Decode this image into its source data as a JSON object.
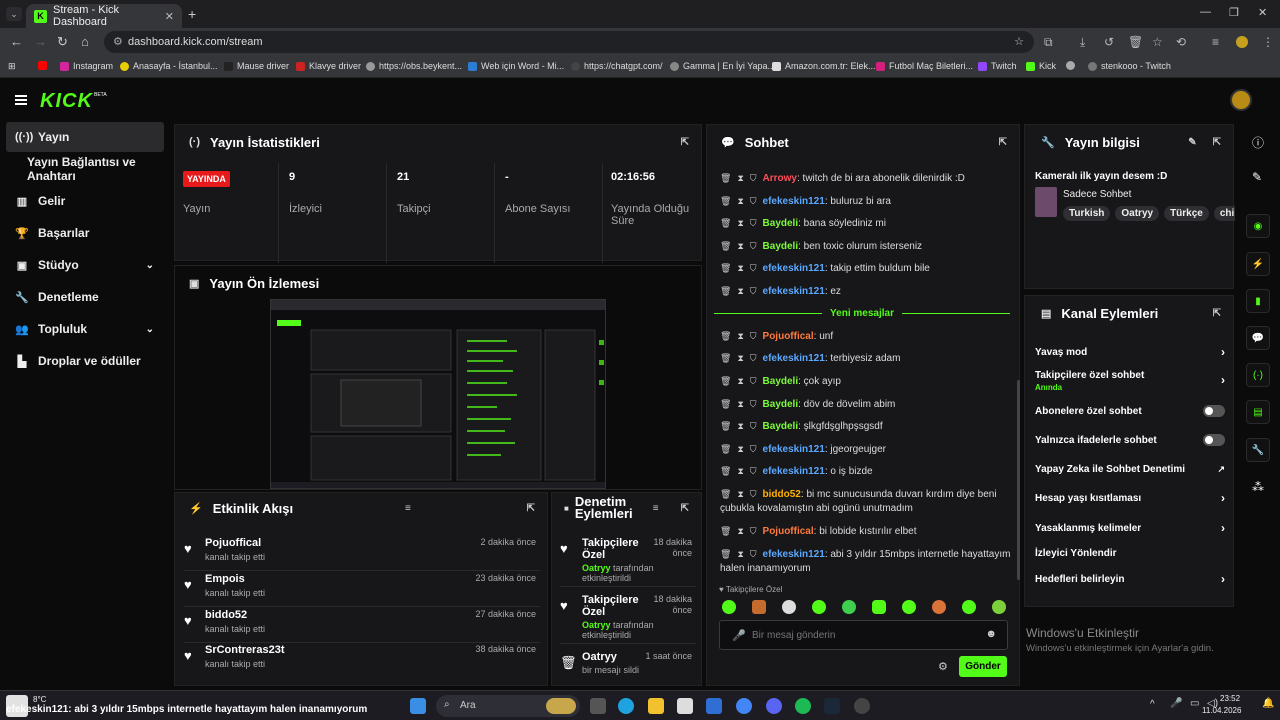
{
  "browser": {
    "tab_title": "Stream - Kick Dashboard",
    "url": "dashboard.kick.com/stream",
    "bookmarks": [
      "Instagram",
      "Anasayfa - İstanbul...",
      "Mause driver",
      "Klavye driver",
      "https://obs.beykent...",
      "Web için Word - Mi...",
      "https://chatgpt.com/",
      "Gamma | En İyi Yapa...",
      "Amazon.com.tr: Elek...",
      "Futbol Maç Biletleri...",
      "Twitch",
      "Kick",
      "stenkooo - Twitch"
    ]
  },
  "kick": {
    "logo": "KICK",
    "beta": "BETA"
  },
  "sidebar": {
    "items": [
      {
        "label": "Yayın"
      },
      {
        "label": "Yayın Bağlantısı ve Anahtarı"
      },
      {
        "label": "Gelir"
      },
      {
        "label": "Başarılar"
      },
      {
        "label": "Stüdyo"
      },
      {
        "label": "Denetleme"
      },
      {
        "label": "Topluluk"
      },
      {
        "label": "Droplar ve ödüller"
      }
    ]
  },
  "stats": {
    "title": "Yayın İstatistikleri",
    "live_badge": "YAYINDA",
    "items": [
      {
        "value": "",
        "label": "Yayın"
      },
      {
        "value": "9",
        "label": "İzleyici"
      },
      {
        "value": "21",
        "label": "Takipçi"
      },
      {
        "value": "-",
        "label": "Abone Sayısı"
      },
      {
        "value": "02:16:56",
        "label": "Yayında Olduğu Süre"
      }
    ]
  },
  "preview": {
    "title": "Yayın Ön İzlemesi"
  },
  "activity": {
    "title": "Etkinlik Akışı",
    "items": [
      {
        "name": "Pojuoffical",
        "sub": "kanalı takip etti",
        "time": "2 dakika önce"
      },
      {
        "name": "Empois",
        "sub": "kanalı takip etti",
        "time": "23 dakika önce"
      },
      {
        "name": "biddo52",
        "sub": "kanalı takip etti",
        "time": "27 dakika önce"
      },
      {
        "name": "SrContreras23t",
        "sub": "kanalı takip etti",
        "time": "38 dakika önce"
      }
    ]
  },
  "moderation": {
    "title": "Denetim Eylemleri",
    "items": [
      {
        "name": "Takipçilere Özel",
        "time": "18 dakika önce",
        "actor": "Oatryy",
        "sub": "tarafından etkinleştirildi"
      },
      {
        "name": "Takipçilere Özel",
        "time": "18 dakika önce",
        "actor": "Oatryy",
        "sub": "tarafından etkinleştirildi"
      },
      {
        "name": "Oatryy",
        "time": "1 saat önce",
        "actor": "",
        "sub": "bir mesajı sildi"
      }
    ]
  },
  "chat": {
    "title": "Sohbet",
    "messages_top": [
      {
        "name": "Arrowy",
        "color": "#ff4d5a",
        "text": "twitch de bi ara abonelik dilenirdik :D"
      },
      {
        "name": "efekeskin121",
        "color": "#5aa9ff",
        "text": "buluruz bi ara"
      },
      {
        "name": "Baydeli",
        "color": "#7cfc3a",
        "text": "bana söylediniz mi"
      },
      {
        "name": "Baydeli",
        "color": "#7cfc3a",
        "text": "ben toxic olurum isterseniz"
      },
      {
        "name": "efekeskin121",
        "color": "#5aa9ff",
        "text": "takip ettim buldum bile"
      },
      {
        "name": "efekeskin121",
        "color": "#5aa9ff",
        "text": "ez"
      }
    ],
    "new_messages": "Yeni mesajlar",
    "messages_bottom": [
      {
        "name": "Pojuoffical",
        "color": "#ff7a3d",
        "text": "unf"
      },
      {
        "name": "efekeskin121",
        "color": "#5aa9ff",
        "text": "terbiyesiz adam"
      },
      {
        "name": "Baydeli",
        "color": "#7cfc3a",
        "text": "çok ayıp"
      },
      {
        "name": "Baydeli",
        "color": "#7cfc3a",
        "text": "döv de dövelim abim"
      },
      {
        "name": "Baydeli",
        "color": "#7cfc3a",
        "text": "şlkgfdşglhpşsgsdf"
      },
      {
        "name": "efekeskin121",
        "color": "#5aa9ff",
        "text": "jgeorgeujger"
      },
      {
        "name": "efekeskin121",
        "color": "#5aa9ff",
        "text": "o iş bizde"
      },
      {
        "name": "biddo52",
        "color": "#ffb000",
        "text": "bi mc sunucusunda duvarı kırdım diye beni çubukla kovalamıştın abi ogünü unutmadım"
      },
      {
        "name": "Pojuoffical",
        "color": "#ff7a3d",
        "text": "bi lobide kıstırılır elbet"
      },
      {
        "name": "efekeskin121",
        "color": "#5aa9ff",
        "text": "abi 3 yıldır 15mbps internetle hayattayım halen inanamıyorum"
      }
    ],
    "followers_only": "Takipçilere Özel",
    "placeholder": "Bir mesaj gönderin",
    "send": "Gönder"
  },
  "channel_info": {
    "title": "Yayın bilgisi",
    "stream_title": "Kameralı ilk yayın desem :D",
    "category": "Sadece Sohbet",
    "tags": [
      "Turkish",
      "Oatryy",
      "Türkçe",
      "chil"
    ]
  },
  "channel_actions": {
    "title": "Kanal Eylemleri",
    "items": [
      {
        "label": "Yavaş mod",
        "sub": ""
      },
      {
        "label": "Takipçilere özel sohbet",
        "sub": "Anında"
      },
      {
        "label": "Abonelere özel sohbet",
        "sub": ""
      },
      {
        "label": "Yalnızca ifadelerle sohbet",
        "sub": ""
      },
      {
        "label": "Yapay Zeka ile Sohbet Denetimi",
        "sub": ""
      },
      {
        "label": "Hesap yaşı kısıtlaması",
        "sub": ""
      },
      {
        "label": "Yasaklanmış kelimeler",
        "sub": ""
      },
      {
        "label": "İzleyici Yönlendir",
        "sub": ""
      },
      {
        "label": "Hedefleri belirleyin",
        "sub": ""
      }
    ]
  },
  "watermark": {
    "line1": "Windows'u Etkinleştir",
    "line2": "Windows'u etkinleştirmek için Ayarlar'a gidin."
  },
  "taskbar": {
    "weather": "8°C",
    "ticker": "efekeskin121: abi 3 yıldır 15mbps internetle hayattayım halen inanamıyorum",
    "search": "Ara",
    "time": "23:52",
    "date": "11.04.2026"
  },
  "colors": {
    "accent": "#53fc18",
    "live": "#e8191a",
    "panel": "#17171a"
  }
}
